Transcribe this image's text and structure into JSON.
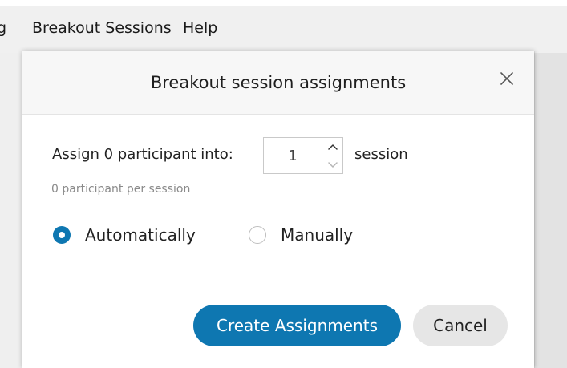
{
  "menubar": {
    "clipped_item": "g",
    "items": [
      {
        "mnemonic": "B",
        "rest": "reakout Sessions"
      },
      {
        "mnemonic": "H",
        "rest": "elp"
      }
    ]
  },
  "dialog": {
    "title": "Breakout session assignments",
    "assign_label": "Assign 0 participant into:",
    "session_count": "1",
    "session_label": "session",
    "per_session_text": "0 participant per session",
    "options": [
      {
        "label": "Automatically",
        "selected": true
      },
      {
        "label": "Manually",
        "selected": false
      }
    ],
    "create_button": "Create Assignments",
    "cancel_button": "Cancel"
  },
  "colors": {
    "accent": "#0e77b1",
    "cancel_bg": "#e6e6e6",
    "header_bg": "#f7f7f7",
    "menubar_bg": "#f0f0f0"
  },
  "icons": {
    "close": "close-icon",
    "up": "chevron-up-icon",
    "down": "chevron-down-icon"
  }
}
